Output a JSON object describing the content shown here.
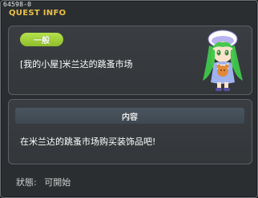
{
  "window": {
    "quest_id": "64598-0",
    "title": "QUEST INFO"
  },
  "quest": {
    "category": "一般",
    "name": "[我的小屋]米兰达的跳蚤市场",
    "category_color": "#9ccb33",
    "npc_icon": "green-haired-girl-npc"
  },
  "content": {
    "header": "内容",
    "text": "在米兰达的跳蚤市场购买装饰品吧!"
  },
  "status": {
    "label": "狀態:",
    "value": "可開始"
  }
}
